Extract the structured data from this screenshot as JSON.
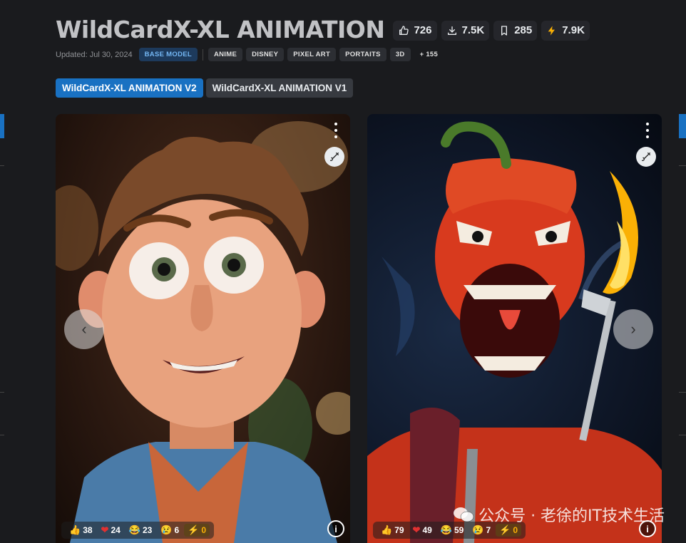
{
  "header": {
    "title": "WildCardX-XL ANIMATION",
    "stats": {
      "likes": "726",
      "downloads": "7.5K",
      "bookmarks": "285",
      "buzz": "7.9K"
    }
  },
  "meta": {
    "updated": "Updated: Jul 30, 2024",
    "base_model_label": "BASE MODEL",
    "tags": [
      "ANIME",
      "DISNEY",
      "PIXEL ART",
      "PORTAITS",
      "3D"
    ],
    "more_tags": "+ 155"
  },
  "versions": [
    {
      "label": "WildCardX-XL ANIMATION V2",
      "active": true
    },
    {
      "label": "WildCardX-XL ANIMATION V1",
      "active": false
    }
  ],
  "cards": [
    {
      "subject": "cartoon man portrait",
      "reactions": {
        "like": "38",
        "heart": "24",
        "laugh": "23",
        "cry": "6",
        "buzz": "0"
      },
      "nav": "prev"
    },
    {
      "subject": "demonic chili pepper with fork and knife",
      "reactions": {
        "like": "79",
        "heart": "49",
        "laugh": "59",
        "cry": "7",
        "buzz": "0"
      },
      "nav": "next"
    }
  ],
  "icons": {
    "like": "thumbs-up-icon",
    "download": "download-icon",
    "bookmark": "bookmark-icon",
    "buzz": "lightning-icon",
    "remix": "brush-icon",
    "info": "info-icon",
    "menu": "kebab-menu-icon"
  },
  "glyphs": {
    "prev": "‹",
    "next": "›",
    "info": "i",
    "like": "👍",
    "heart": "❤",
    "laugh": "😂",
    "cry": "😢",
    "bolt": "⚡"
  },
  "watermark": "公众号 · 老徐的IT技术生活",
  "colors": {
    "background": "#1a1b1e",
    "accent": "#1971c2",
    "buzz": "#fab005"
  }
}
